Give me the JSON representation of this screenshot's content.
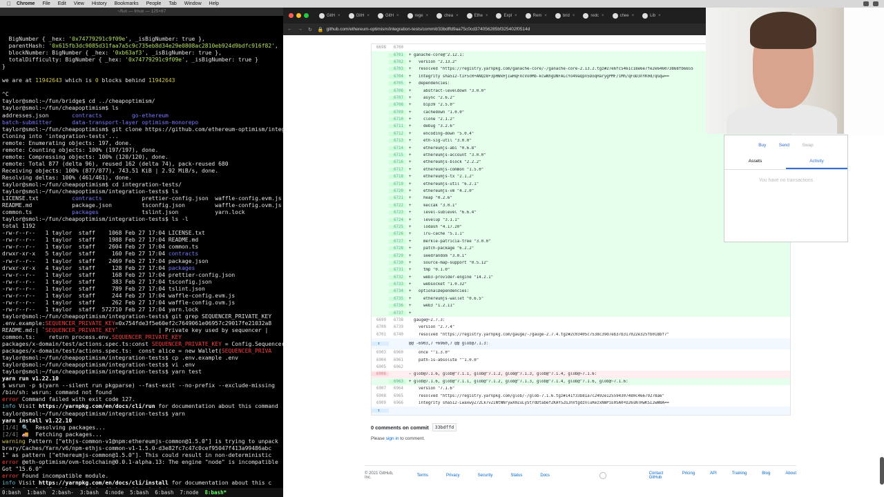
{
  "menubar": {
    "app": "Chrome",
    "items": [
      "File",
      "Edit",
      "View",
      "History",
      "Bookmarks",
      "People",
      "Tab",
      "Window",
      "Help"
    ]
  },
  "terminal": {
    "title": "~/fun — tmux — 125×67",
    "lines": [
      [
        [
          "  BigNumber { _hex: ",
          "w0"
        ],
        [
          "'0x74779291c9f09e'",
          "g"
        ],
        [
          ", _isBigNumber: true },",
          ""
        ]
      ],
      [
        [
          "  parentHash: ",
          ""
        ],
        [
          "'0x615fb3dc9085d31faa7a5c9c735eb8d34e29e0808ac2810eb924d9bdfc916f82'",
          "g"
        ],
        [
          ",",
          ""
        ]
      ],
      [
        [
          "  blockNumber: BigNumber { _hex: ",
          ""
        ],
        [
          "'0xb63af3'",
          "g"
        ],
        [
          ", _isBigNumber: true },",
          ""
        ]
      ],
      [
        [
          "  totalDifficulty: BigNumber { _hex: ",
          ""
        ],
        [
          "'0x74779291c9f09e'",
          "g"
        ],
        [
          ", _isBigNumber: true }",
          ""
        ]
      ],
      [
        [
          "}",
          ""
        ]
      ],
      [
        [
          "",
          ""
        ]
      ],
      [
        [
          "we are at ",
          ""
        ],
        [
          "11942643",
          "y"
        ],
        [
          " which is ",
          ""
        ],
        [
          "0",
          "y"
        ],
        [
          " blocks behind ",
          ""
        ],
        [
          "11942643",
          "y"
        ]
      ],
      [
        [
          "",
          ""
        ]
      ],
      [
        [
          "^C",
          ""
        ]
      ],
      [
        [
          "taylor@smol:~/fun/bridge$ cd ../cheapoptimism/",
          ""
        ]
      ],
      [
        [
          "taylor@smol:~/fun/cheapoptimism$ ls",
          ""
        ]
      ],
      [
        [
          "addresses.json       ",
          ""
        ],
        [
          "contracts",
          "b"
        ],
        [
          "         ",
          ""
        ],
        [
          "go-ethereum",
          "b"
        ]
      ],
      [
        [
          "batch-submitter",
          "b"
        ],
        [
          "      ",
          ""
        ],
        [
          "data-transport-layer",
          "b"
        ],
        [
          " ",
          ""
        ],
        [
          "optimism-monorepo",
          "b"
        ]
      ],
      [
        [
          "taylor@smol:~/fun/cheapoptimism$ git clone https://github.com/ethereum-optimism/integration-tests",
          ""
        ]
      ],
      [
        [
          "Cloning into 'integration-tests'...",
          ""
        ]
      ],
      [
        [
          "remote: Enumerating objects: 197, done.",
          ""
        ]
      ],
      [
        [
          "remote: Counting objects: 100% (197/197), done.",
          ""
        ]
      ],
      [
        [
          "remote: Compressing objects: 100% (120/120), done.",
          ""
        ]
      ],
      [
        [
          "remote: Total 877 (delta 96), reused 162 (delta 74), pack-reused 680",
          ""
        ]
      ],
      [
        [
          "Receiving objects: 100% (877/877), 743.51 KiB | 2.92 MiB/s, done.",
          ""
        ]
      ],
      [
        [
          "Resolving deltas: 100% (461/461), done.",
          ""
        ]
      ],
      [
        [
          "taylor@smol:~/fun/cheapoptimism$ cd integration-tests/",
          ""
        ]
      ],
      [
        [
          "taylor@smol:~/fun/cheapoptimism/integration-tests$ ls",
          ""
        ]
      ],
      [
        [
          "LICENSE.txt          ",
          ""
        ],
        [
          "contracts",
          "b"
        ],
        [
          "            prettier-config.json  waffle-config.evm.js",
          ""
        ]
      ],
      [
        [
          "README.md            package.json         tsconfig.json         waffle-config.ovm.js",
          ""
        ]
      ],
      [
        [
          "common.ts            ",
          ""
        ],
        [
          "packages",
          "b"
        ],
        [
          "             tslint.json           yarn.lock",
          ""
        ]
      ],
      [
        [
          "taylor@smol:~/fun/cheapoptimism/integration-tests$ ls -l",
          ""
        ]
      ],
      [
        [
          "total 1192",
          ""
        ]
      ],
      [
        [
          "-rw-r--r--   1 taylor  staff    1068 Feb 27 17:04 LICENSE.txt",
          ""
        ]
      ],
      [
        [
          "-rw-r--r--   1 taylor  staff    1988 Feb 27 17:04 README.md",
          ""
        ]
      ],
      [
        [
          "-rw-r--r--   1 taylor  staff    2604 Feb 27 17:04 common.ts",
          ""
        ]
      ],
      [
        [
          "drwxr-xr-x   5 taylor  staff     160 Feb 27 17:04 ",
          ""
        ],
        [
          "contracts",
          "b"
        ]
      ],
      [
        [
          "-rw-r--r--   1 taylor  staff    2469 Feb 27 17:04 package.json",
          ""
        ]
      ],
      [
        [
          "drwxr-xr-x   4 taylor  staff     128 Feb 27 17:04 ",
          ""
        ],
        [
          "packages",
          "b"
        ]
      ],
      [
        [
          "-rw-r--r--   1 taylor  staff     168 Feb 27 17:04 prettier-config.json",
          ""
        ]
      ],
      [
        [
          "-rw-r--r--   1 taylor  staff     383 Feb 27 17:04 tsconfig.json",
          ""
        ]
      ],
      [
        [
          "-rw-r--r--   1 taylor  staff     789 Feb 27 17:04 tslint.json",
          ""
        ]
      ],
      [
        [
          "-rw-r--r--   1 taylor  staff     244 Feb 27 17:04 waffle-config.evm.js",
          ""
        ]
      ],
      [
        [
          "-rw-r--r--   1 taylor  staff     262 Feb 27 17:04 waffle-config.ovm.js",
          ""
        ]
      ],
      [
        [
          "-rw-r--r--   1 taylor  staff  572710 Feb 27 17:04 yarn.lock",
          ""
        ]
      ],
      [
        [
          "taylor@smol:~/fun/cheapoptimism/integration-tests$ git grep SEQUENCER_PRIVATE_KEY",
          ""
        ]
      ],
      [
        [
          ".env.example:",
          ""
        ],
        [
          "SEQUENCER_PRIVATE_KEY",
          "r"
        ],
        [
          "=0x754fde3f5e60ef2c7649061e06957c29017fe21032a8",
          ""
        ]
      ],
      [
        [
          "README.md:| `",
          ""
        ],
        [
          "SEQUENCER_PRIVATE_KEY",
          "r"
        ],
        [
          "`            | Private key used by sequencer |",
          ""
        ]
      ],
      [
        [
          "common.ts:    return process.env.",
          ""
        ],
        [
          "SEQUENCER_PRIVATE_KEY",
          "r"
        ]
      ],
      [
        [
          "packages/x-domain/test/actions.spec.ts:const ",
          ""
        ],
        [
          "SEQUENCER_PRIVATE_KEY",
          "r"
        ],
        [
          " = Config.Sequencer",
          ""
        ]
      ],
      [
        [
          "packages/x-domain/test/actions.spec.ts:  const alice = new Wallet(",
          ""
        ],
        [
          "SEQUENCER_PRIVA",
          "r"
        ]
      ],
      [
        [
          "taylor@smol:~/fun/cheapoptimism/integration-tests$ cp .env.example .env",
          ""
        ]
      ],
      [
        [
          "taylor@smol:~/fun/cheapoptimism/integration-tests$ vi .env",
          ""
        ]
      ],
      [
        [
          "taylor@smol:~/fun/cheapoptimism/integration-tests$ yarn test",
          ""
        ]
      ],
      [
        [
          "yarn run v1.22.10",
          "wb"
        ]
      ],
      [
        [
          "$ wsrun -p $(yarn --silent run pkgparse) --fast-exit --no-prefix --exclude-missing",
          ""
        ]
      ],
      [
        [
          "/bin/sh: wsrun: command not found",
          ""
        ]
      ],
      [
        [
          "error",
          "r"
        ],
        [
          " Command failed with exit code 127.",
          ""
        ]
      ],
      [
        [
          "info",
          "c"
        ],
        [
          " Visit ",
          ""
        ],
        [
          "https://yarnpkg.com/en/docs/cli/run",
          "wb"
        ],
        [
          " for documentation about this command",
          ""
        ]
      ],
      [
        [
          "taylor@smol:~/fun/cheapoptimism/integration-tests$ yarn",
          ""
        ]
      ],
      [
        [
          "yarn install v1.22.10",
          "wb"
        ]
      ],
      [
        [
          "[1/4]",
          "gr"
        ],
        [
          " 🔍  Resolving packages...",
          ""
        ]
      ],
      [
        [
          "[2/4]",
          "gr"
        ],
        [
          " 🚚  Fetching packages...",
          ""
        ]
      ],
      [
        [
          "warning",
          "y"
        ],
        [
          " Pattern [\"ethjs-common-v1@npm:ethereumjs-common@1.5.0\"] is trying to unpack",
          ""
        ]
      ],
      [
        [
          "brary/Caches/Yarn/v6/npm-ethjs-common-v1-1.5.0-d3e82fc7c47c0cef95047f413a99486abc",
          ""
        ]
      ],
      [
        [
          "1\" as pattern [\"ethereumjs-common@1.5.0\"]. This could result in non-deterministic",
          ""
        ]
      ],
      [
        [
          "error",
          "r"
        ],
        [
          " @eth-optimism/ovm-toolchain@0.0.1-alpha.13: The engine \"node\" is incompatible",
          ""
        ]
      ],
      [
        [
          "Got \"15.6.0\"",
          ""
        ]
      ],
      [
        [
          "error",
          "r"
        ],
        [
          " Found incompatible module.",
          ""
        ]
      ],
      [
        [
          "info",
          "c"
        ],
        [
          " Visit ",
          ""
        ],
        [
          "https://yarnpkg.com/en/docs/cli/install",
          "wb"
        ],
        [
          " for documentation about this c",
          ""
        ]
      ],
      [
        [
          "taylor@smol:~/fun/cheapoptimism/integration-tests$ ",
          ""
        ]
      ]
    ],
    "tmux_windows": [
      "0:bash",
      "1:bash",
      "2:bash-",
      "3:bash",
      "4:node",
      "5:bash",
      "6:bash",
      "7:node",
      "8:bash*"
    ]
  },
  "browser": {
    "tabs": [
      "GitH",
      "GitH",
      "GitH",
      "rege",
      "chea",
      "Ethe",
      "Expl",
      "Rem",
      "brid",
      "redc",
      "chee",
      "Lib"
    ],
    "url": "github.com/ethereum-optimism/integration-tests/commit/33bdffd9aa75c0cd374056285bf325402f0514d",
    "diff_rows": [
      {
        "t": "ctx",
        "n1": "6698",
        "n2": "6700",
        "c": ""
      },
      {
        "t": "add",
        "n1": "",
        "n2": "6701",
        "c": "+ ganache-core@^2.12.1:"
      },
      {
        "t": "add",
        "n1": "",
        "n2": "6702",
        "c": "+   version \"2.13.2\""
      },
      {
        "t": "add",
        "n1": "",
        "n2": "6703",
        "c": "+   resolved \"https://registry.yarnpkg.com/ganache-core/-/ganache-core-2.13.2.tgz#27e6fc5461c18e6e7fe2e646073868fb6655"
      },
      {
        "t": "add",
        "n1": "",
        "n2": "6704",
        "c": "+   integrity sha512-tIF5cR+ANQz8+3pHWxHjIwHqFXcVo0Mb-kcwNhgUNFALcYo49aQpn5DoqHarygPMF/iMh/qFoD3nYK0d/qGqw=="
      },
      {
        "t": "add",
        "n1": "",
        "n2": "6705",
        "c": "+   dependencies:"
      },
      {
        "t": "add",
        "n1": "",
        "n2": "6706",
        "c": "+     abstract-leveldown \"3.0.0\""
      },
      {
        "t": "add",
        "n1": "",
        "n2": "6707",
        "c": "+     async \"2.6.2\""
      },
      {
        "t": "add",
        "n1": "",
        "n2": "6708",
        "c": "+     bip39 \"2.5.0\""
      },
      {
        "t": "add",
        "n1": "",
        "n2": "6709",
        "c": "+     cachedown \"1.0.0\""
      },
      {
        "t": "add",
        "n1": "",
        "n2": "6710",
        "c": "+     clone \"2.1.2\""
      },
      {
        "t": "add",
        "n1": "",
        "n2": "6711",
        "c": "+     debug \"3.2.6\""
      },
      {
        "t": "add",
        "n1": "",
        "n2": "6712",
        "c": "+     encoding-down \"5.0.4\""
      },
      {
        "t": "add",
        "n1": "",
        "n2": "6713",
        "c": "+     eth-sig-util \"3.0.0\""
      },
      {
        "t": "add",
        "n1": "",
        "n2": "6714",
        "c": "+     ethereumjs-abi \"0.6.8\""
      },
      {
        "t": "add",
        "n1": "",
        "n2": "6715",
        "c": "+     ethereumjs-account \"3.0.0\""
      },
      {
        "t": "add",
        "n1": "",
        "n2": "6716",
        "c": "+     ethereumjs-block \"2.2.2\""
      },
      {
        "t": "add",
        "n1": "",
        "n2": "6717",
        "c": "+     ethereumjs-common \"1.5.0\""
      },
      {
        "t": "add",
        "n1": "",
        "n2": "6718",
        "c": "+     ethereumjs-tx \"2.1.2\""
      },
      {
        "t": "add",
        "n1": "",
        "n2": "6719",
        "c": "+     ethereumjs-util \"6.2.1\""
      },
      {
        "t": "add",
        "n1": "",
        "n2": "6720",
        "c": "+     ethereumjs-vm \"4.2.0\""
      },
      {
        "t": "add",
        "n1": "",
        "n2": "6721",
        "c": "+     heap \"0.2.6\""
      },
      {
        "t": "add",
        "n1": "",
        "n2": "6722",
        "c": "+     keccak \"3.0.1\""
      },
      {
        "t": "add",
        "n1": "",
        "n2": "6723",
        "c": "+     level-sublevel \"6.6.4\""
      },
      {
        "t": "add",
        "n1": "",
        "n2": "6724",
        "c": "+     levelup \"3.1.1\""
      },
      {
        "t": "add",
        "n1": "",
        "n2": "6725",
        "c": "+     lodash \"4.17.20\""
      },
      {
        "t": "add",
        "n1": "",
        "n2": "6726",
        "c": "+     lru-cache \"5.1.1\""
      },
      {
        "t": "add",
        "n1": "",
        "n2": "6727",
        "c": "+     merkle-patricia-tree \"3.0.0\""
      },
      {
        "t": "add",
        "n1": "",
        "n2": "6728",
        "c": "+     patch-package \"6.2.2\""
      },
      {
        "t": "add",
        "n1": "",
        "n2": "6729",
        "c": "+     seedrandom \"3.0.1\""
      },
      {
        "t": "add",
        "n1": "",
        "n2": "6730",
        "c": "+     source-map-support \"0.5.12\""
      },
      {
        "t": "add",
        "n1": "",
        "n2": "6731",
        "c": "+     tmp \"0.1.0\""
      },
      {
        "t": "add",
        "n1": "",
        "n2": "6732",
        "c": "+     web3-provider-engine \"14.2.1\""
      },
      {
        "t": "add",
        "n1": "",
        "n2": "6733",
        "c": "+     websocket \"1.0.32\""
      },
      {
        "t": "add",
        "n1": "",
        "n2": "6734",
        "c": "+   optionalDependencies:"
      },
      {
        "t": "add",
        "n1": "",
        "n2": "6735",
        "c": "+     ethereumjs-wallet \"0.6.5\""
      },
      {
        "t": "add",
        "n1": "",
        "n2": "6736",
        "c": "+     web3 \"1.2.11\""
      },
      {
        "t": "add",
        "n1": "",
        "n2": "6737",
        "c": "+"
      },
      {
        "t": "ctx",
        "n1": "6699",
        "n2": "6738",
        "c": "  gauge@~2.7.3:"
      },
      {
        "t": "ctx",
        "n1": "6700",
        "n2": "6739",
        "c": "    version \"2.7.4\""
      },
      {
        "t": "ctx",
        "n1": "6701",
        "n2": "6740",
        "c": "    resolved \"https://registry.yarnpkg.com/gauge/-/gauge-2.7.4.tgz#2c03405c7538c39d7eb37b317022e325fb018bf7\""
      },
      {
        "t": "hunk",
        "n1": "↕",
        "n2": "",
        "c": "@@ -6903,7 +6960,7 @@ glob@7.1.3:"
      },
      {
        "t": "ctx",
        "n1": "6903",
        "n2": "6960",
        "c": "    once \"^1.3.0\""
      },
      {
        "t": "ctx",
        "n1": "6904",
        "n2": "6961",
        "c": "    path-is-absolute \"^1.0.0\""
      },
      {
        "t": "ctx",
        "n1": "6905",
        "n2": "6962",
        "c": ""
      },
      {
        "t": "del",
        "n1": "6906",
        "n2": "",
        "c": "- glob@7.1.6, glob@^7.1.1, glob@^7.1.2, glob@^7.1.3, glob@^7.1.4, glob@~7.1.6:"
      },
      {
        "t": "add",
        "n1": "",
        "n2": "6963",
        "c": "+ glob@7.1.6, glob@^7.1.1, glob@^7.1.2, glob@^7.1.3, glob@^7.1.4, glob@^7.1.6, glob@~7.1.6:"
      },
      {
        "t": "ctx",
        "n1": "6907",
        "n2": "6964",
        "c": "    version \"7.1.6\""
      },
      {
        "t": "ctx",
        "n1": "6908",
        "n2": "6965",
        "c": "    resolved \"https://registry.yarnpkg.com/glob/-/glob-7.1.6.tgz#141f33b81a7c2492e125594307480c46679278a6\""
      },
      {
        "t": "ctx",
        "n1": "6909",
        "n2": "6966",
        "c": "    integrity sha512-LwaxwyZ72Lk7vZINtNNrywX0ZuLyStrdDtabefZKAY5ZGJhVtgdznluRezxNmPiE0SA0+D26sNTHwKSI2wW8A=="
      },
      {
        "t": "expand",
        "n1": "↕",
        "n2": "",
        "c": ""
      }
    ],
    "comments_count": "0 comments on commit",
    "commit_sha": "33bdffd",
    "signin_prefix": "Please ",
    "signin_link": "sign in",
    "signin_suffix": " to comment.",
    "footer": {
      "copyright": "© 2021 GitHub, Inc.",
      "left_links": [
        "Terms",
        "Privacy",
        "Security",
        "Status",
        "Docs"
      ],
      "right_links": [
        "Contact GitHub",
        "Pricing",
        "API",
        "Training",
        "Blog",
        "About"
      ]
    },
    "wallet": {
      "actions": [
        "Buy",
        "Send",
        "Swap"
      ],
      "tabs": [
        "Assets",
        "Activity"
      ],
      "selected_tab": "Activity",
      "empty": "You have no transactions"
    }
  },
  "colors": {
    "terminal_bg": "#000000",
    "diff_add": "#e6ffed",
    "diff_del": "#ffeef0",
    "link": "#0366d6"
  }
}
